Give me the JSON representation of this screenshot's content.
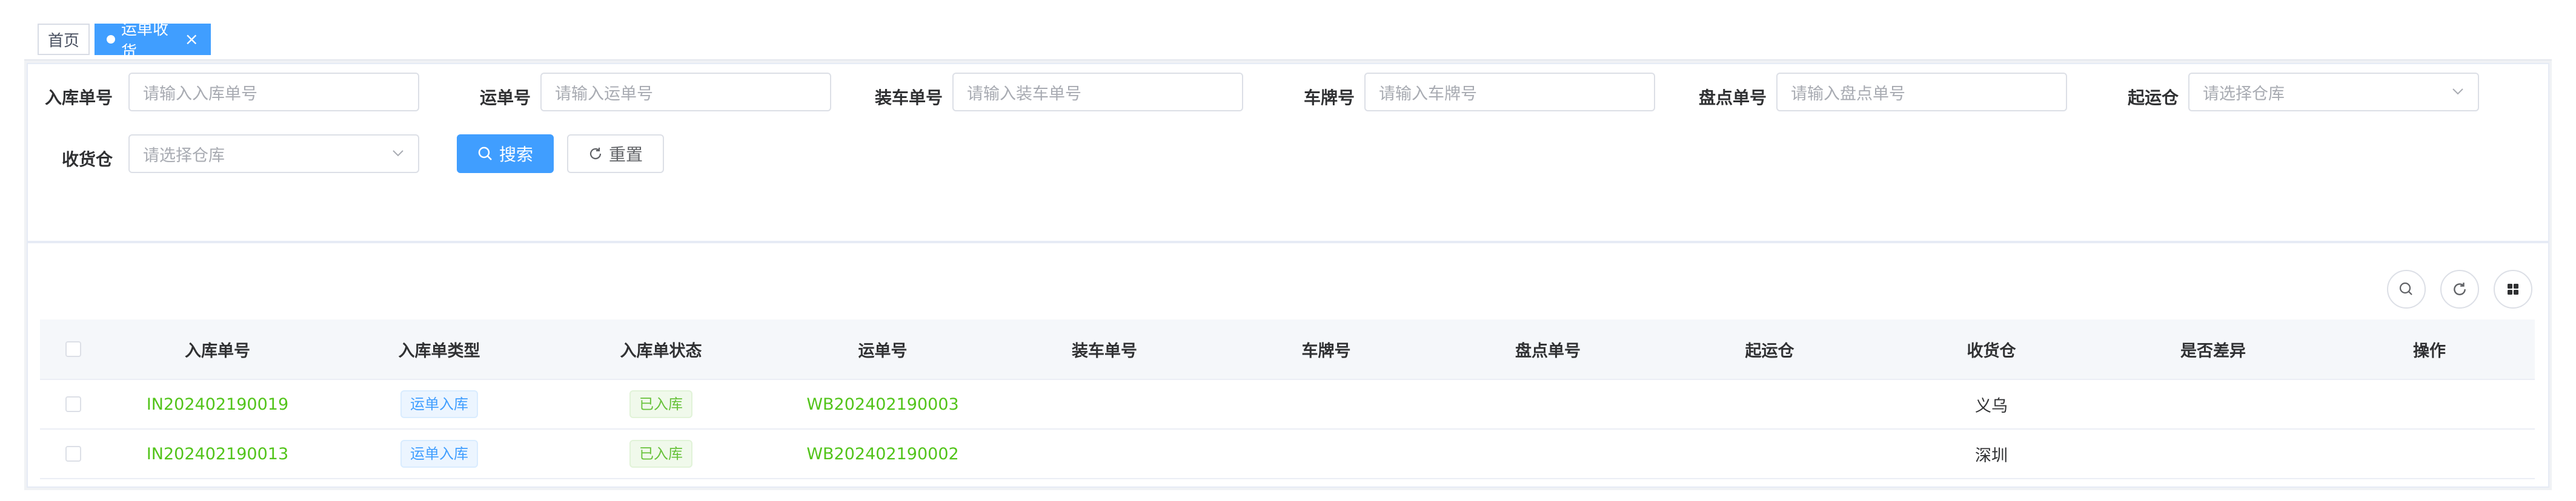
{
  "tabs": {
    "home_label": "首页",
    "active_label": "运单收货"
  },
  "search": {
    "fields": [
      {
        "label": "入库单号",
        "placeholder": "请输入入库单号"
      },
      {
        "label": "运单号",
        "placeholder": "请输入运单号"
      },
      {
        "label": "装车单号",
        "placeholder": "请输入装车单号"
      },
      {
        "label": "车牌号",
        "placeholder": "请输入车牌号"
      },
      {
        "label": "盘点单号",
        "placeholder": "请输入盘点单号"
      },
      {
        "label": "起运仓",
        "placeholder": "请选择仓库"
      },
      {
        "label": "收货仓",
        "placeholder": "请选择仓库"
      }
    ],
    "search_label": "搜索",
    "reset_label": "重置"
  },
  "table": {
    "columns": [
      "入库单号",
      "入库单类型",
      "入库单状态",
      "运单号",
      "装车单号",
      "车牌号",
      "盘点单号",
      "起运仓",
      "收货仓",
      "是否差异",
      "操作"
    ],
    "rows": [
      {
        "inbound_no": "IN202402190019",
        "type": "运单入库",
        "status": "已入库",
        "waybill_no": "WB202402190003",
        "loading_no": "",
        "plate_no": "",
        "stocktake_no": "",
        "origin_wh": "",
        "dest_wh": "义乌",
        "diff": "",
        "action": ""
      },
      {
        "inbound_no": "IN202402190013",
        "type": "运单入库",
        "status": "已入库",
        "waybill_no": "WB202402190002",
        "loading_no": "",
        "plate_no": "",
        "stocktake_no": "",
        "origin_wh": "",
        "dest_wh": "深圳",
        "diff": "",
        "action": ""
      }
    ]
  },
  "colors": {
    "primary": "#409eff",
    "link_green": "#52c41a",
    "tag_green": "#67c23a"
  },
  "icons": {
    "tab_dot": "dot-icon",
    "tab_close": "close-icon",
    "search": "search-icon",
    "reset": "refresh-icon",
    "toolbar": [
      "search-icon",
      "refresh-icon",
      "grid-icon"
    ]
  }
}
